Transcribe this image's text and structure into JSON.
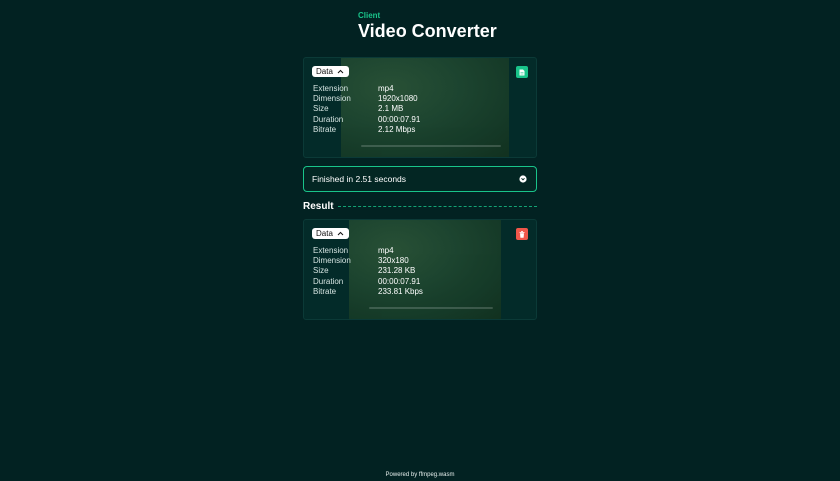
{
  "header": {
    "eyebrow": "Client",
    "title": "Video Converter"
  },
  "input_card": {
    "toggle_label": "Data",
    "props": [
      {
        "key": "Extension",
        "value": "mp4"
      },
      {
        "key": "Dimension",
        "value": "1920x1080"
      },
      {
        "key": "Size",
        "value": "2.1 MB"
      },
      {
        "key": "Duration",
        "value": "00:00:07.91"
      },
      {
        "key": "Bitrate",
        "value": "2.12 Mbps"
      }
    ],
    "action_icon": "file-icon",
    "action_color": "#19c48a"
  },
  "status": {
    "text": "Finished in 2.51 seconds",
    "icon": "chevron-down-circle-icon"
  },
  "result": {
    "heading": "Result"
  },
  "output_card": {
    "toggle_label": "Data",
    "props": [
      {
        "key": "Extension",
        "value": "mp4"
      },
      {
        "key": "Dimension",
        "value": "320x180"
      },
      {
        "key": "Size",
        "value": "231.28 KB"
      },
      {
        "key": "Duration",
        "value": "00:00:07.91"
      },
      {
        "key": "Bitrate",
        "value": "233.81 Kbps"
      }
    ],
    "action_icon": "trash-icon",
    "action_color": "#f0574a"
  },
  "footer": {
    "text": "Powered by ffmpeg.wasm"
  },
  "colors": {
    "background": "#022222",
    "accent": "#19c48a",
    "danger": "#f0574a"
  }
}
